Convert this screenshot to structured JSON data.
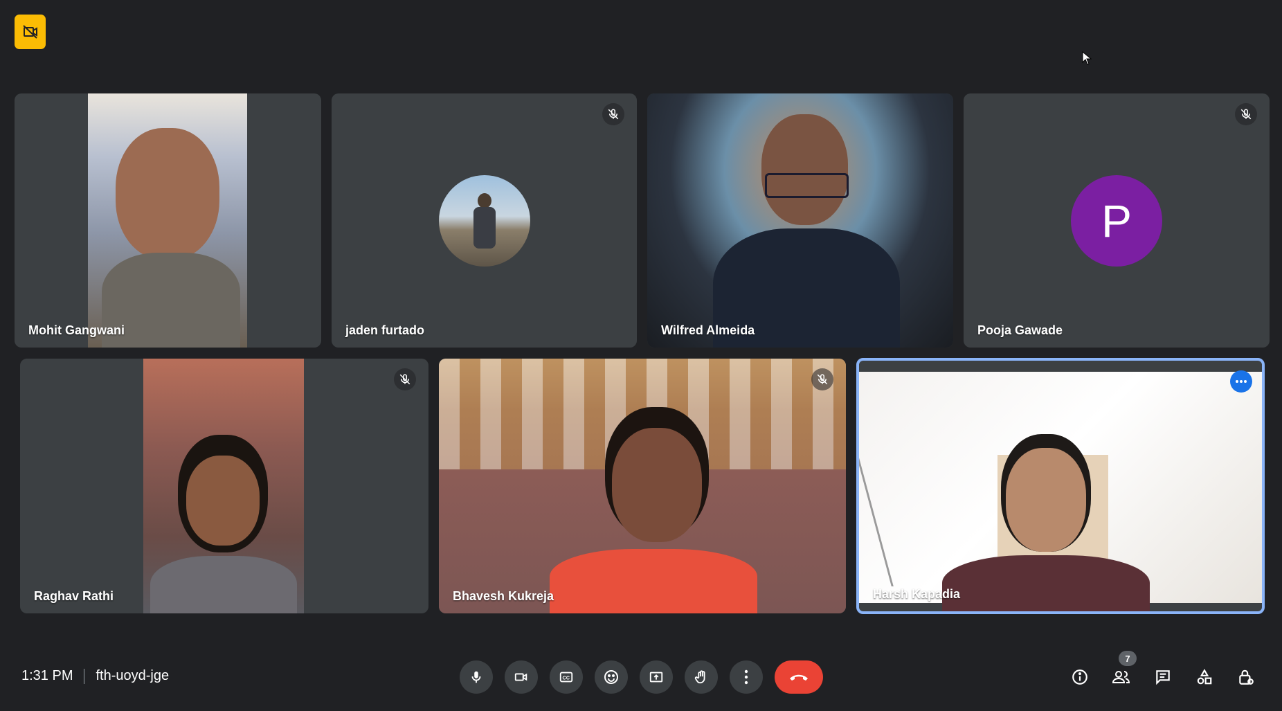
{
  "meeting": {
    "time": "1:31 PM",
    "code": "fth-uoyd-jge",
    "participant_count": "7"
  },
  "participants": [
    {
      "name": "Mohit Gangwani",
      "muted": false,
      "display": "video"
    },
    {
      "name": "jaden furtado",
      "muted": true,
      "display": "photo"
    },
    {
      "name": "Wilfred Almeida",
      "muted": false,
      "display": "video"
    },
    {
      "name": "Pooja Gawade",
      "muted": true,
      "display": "letter",
      "initial": "P",
      "avatar_color": "#7b1fa2"
    },
    {
      "name": "Raghav Rathi",
      "muted": true,
      "display": "video"
    },
    {
      "name": "Bhavesh Kukreja",
      "muted": true,
      "display": "video"
    },
    {
      "name": "Harsh Kapadia",
      "muted": false,
      "display": "video",
      "active_speaker": true
    }
  ],
  "controls": {
    "main": [
      "mic-icon",
      "camera-icon",
      "captions-icon",
      "emoji-icon",
      "present-icon",
      "raise-hand-icon",
      "more-options-icon",
      "end-call-icon"
    ],
    "side": [
      "info-icon",
      "people-icon",
      "chat-icon",
      "activities-icon",
      "host-controls-icon"
    ]
  },
  "colors": {
    "background": "#202124",
    "tile": "#3c4043",
    "end_call": "#ea4335",
    "active_border": "#8ab4f8",
    "logo_badge": "#fbbc04"
  }
}
